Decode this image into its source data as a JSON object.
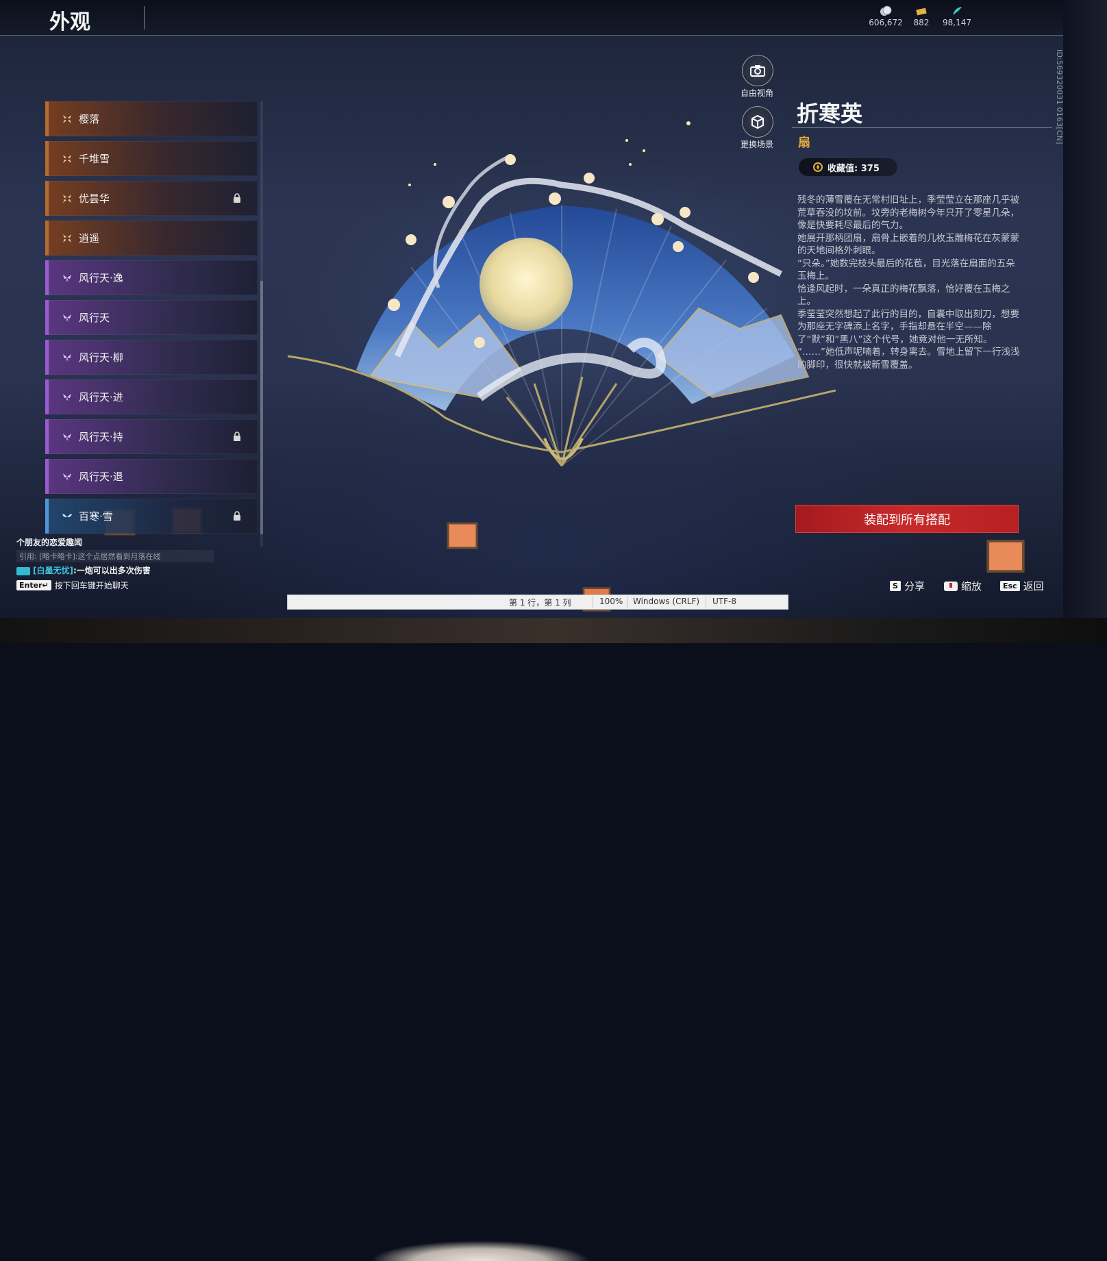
{
  "header": {
    "title": "外观",
    "currencies": [
      {
        "icon": "coin-icon",
        "value": "606,672"
      },
      {
        "icon": "ticket-icon",
        "value": "882"
      },
      {
        "icon": "jade-feather-icon",
        "value": "98,147"
      }
    ]
  },
  "list": {
    "items": [
      {
        "label": "樱落",
        "tier": "orange",
        "locked": false
      },
      {
        "label": "千堆雪",
        "tier": "orange",
        "locked": false
      },
      {
        "label": "优昙华",
        "tier": "orange",
        "locked": true
      },
      {
        "label": "逍遥",
        "tier": "orange",
        "locked": false
      },
      {
        "label": "风行天·逸",
        "tier": "purple",
        "locked": false
      },
      {
        "label": "风行天",
        "tier": "purple",
        "locked": false
      },
      {
        "label": "风行天·柳",
        "tier": "purple",
        "locked": false
      },
      {
        "label": "风行天·进",
        "tier": "purple",
        "locked": false
      },
      {
        "label": "风行天·持",
        "tier": "purple",
        "locked": true
      },
      {
        "label": "风行天·退",
        "tier": "purple",
        "locked": false
      },
      {
        "label": "百寒·雪",
        "tier": "blue",
        "locked": true
      }
    ]
  },
  "view": {
    "free_camera_label": "自由视角",
    "change_scene_label": "更换场景"
  },
  "detail": {
    "name": "折寒英",
    "type": "扇",
    "collection_label": "收藏值: 375",
    "id_text": "ID:569320031 0163[CN]",
    "description": [
      "残冬的薄雪覆在无常村旧址上，季莹莹立在那座几乎被荒草吞没的坟前。坟旁的老梅树今年只开了零星几朵，像是快要耗尽最后的气力。",
      "她展开那柄团扇，扇骨上嵌着的几枚玉雕梅花在灰蒙蒙的天地间格外刺眼。",
      "“只朵。”她数完枝头最后的花苞，目光落在扇面的五朵玉梅上。",
      "恰逢风起时，一朵真正的梅花飘落，恰好覆在玉梅之上。",
      "季莹莹突然想起了此行的目的，自囊中取出刻刀，想要为那座无字碑添上名字，手指却悬在半空——除了“默”和“黑八”这个代号，她竟对他一无所知。",
      "“……”她低声呢喃着，转身离去。雪地上留下一行浅浅的脚印，很快就被新雪覆盖。"
    ],
    "equip_button": "装配到所有搭配"
  },
  "chat": {
    "line1": "个朋友的恋爱趣闻",
    "line2": "引用: [略卡略卡]:这个点居然看到月落在线",
    "line3_name": "[白墨无忧]",
    "line3_text": ":一炮可以出多次伤害",
    "enter_key": "Enter↵",
    "hint": "按下回车键开始聊天"
  },
  "hints": {
    "share_key": "S",
    "share_label": "分享",
    "zoom_label": "缩放",
    "back_key": "Esc",
    "back_label": "返回"
  },
  "statusbar": {
    "position": "第 1 行，第 1 列",
    "zoom": "100%",
    "line_ending": "Windows (CRLF)",
    "encoding": "UTF-8"
  },
  "colors": {
    "orange_tier": "#b56a2e",
    "purple_tier": "#9a5ad0",
    "blue_tier": "#4f96d8",
    "equip_red": "#c72a2a",
    "type_gold": "#e2a63c"
  }
}
